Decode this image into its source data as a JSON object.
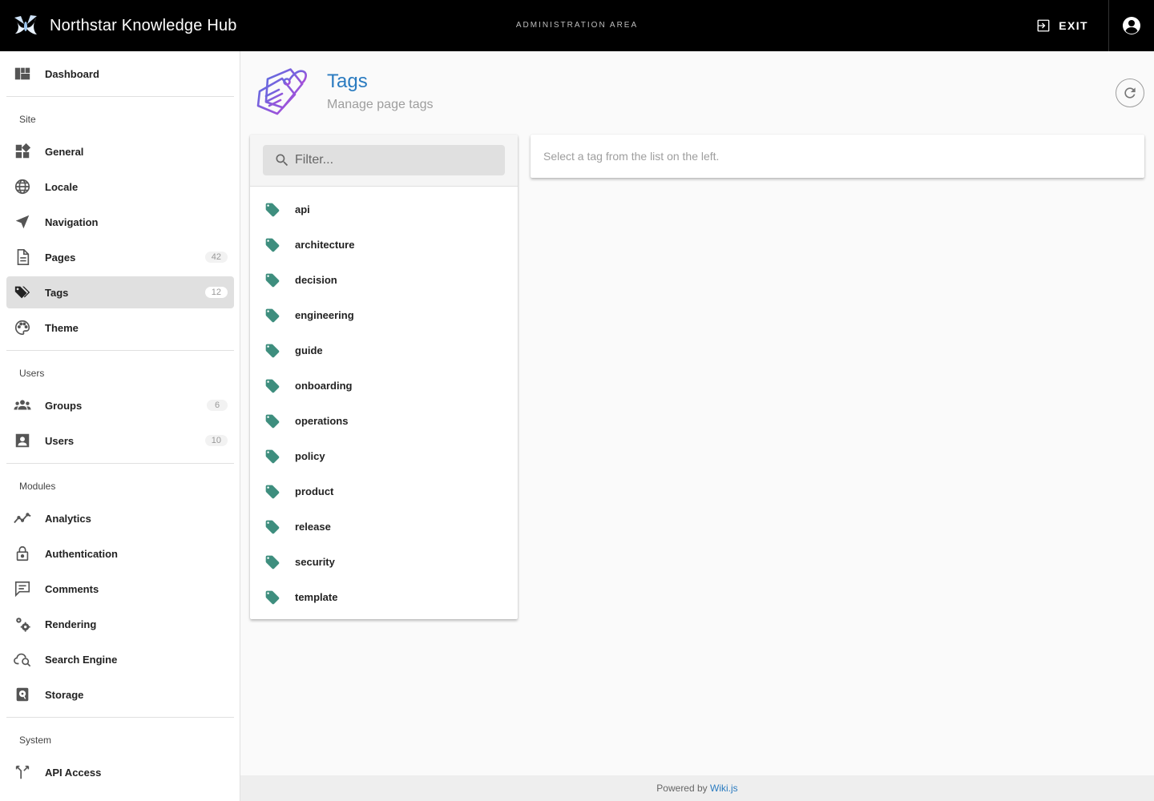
{
  "header": {
    "app_title": "Northstar Knowledge Hub",
    "area_label": "ADMINISTRATION AREA",
    "exit_label": "EXIT"
  },
  "sidebar": {
    "dashboard": {
      "label": "Dashboard",
      "icon": "dashboard-icon"
    },
    "sections": {
      "site": "Site",
      "users": "Users",
      "modules": "Modules",
      "system": "System"
    },
    "site_items": [
      {
        "label": "General",
        "icon": "general-icon"
      },
      {
        "label": "Locale",
        "icon": "globe-icon"
      },
      {
        "label": "Navigation",
        "icon": "navigation-icon"
      },
      {
        "label": "Pages",
        "icon": "page-icon",
        "badge": "42"
      },
      {
        "label": "Tags",
        "icon": "tags-icon",
        "badge": "12",
        "active": true
      },
      {
        "label": "Theme",
        "icon": "palette-icon"
      }
    ],
    "user_items": [
      {
        "label": "Groups",
        "icon": "groups-icon",
        "badge": "6"
      },
      {
        "label": "Users",
        "icon": "user-icon",
        "badge": "10"
      }
    ],
    "module_items": [
      {
        "label": "Analytics",
        "icon": "analytics-icon"
      },
      {
        "label": "Authentication",
        "icon": "lock-icon"
      },
      {
        "label": "Comments",
        "icon": "comment-icon"
      },
      {
        "label": "Rendering",
        "icon": "gears-icon"
      },
      {
        "label": "Search Engine",
        "icon": "cloud-search-icon"
      },
      {
        "label": "Storage",
        "icon": "storage-icon"
      }
    ],
    "system_items": [
      {
        "label": "API Access",
        "icon": "api-icon"
      }
    ]
  },
  "main": {
    "title": "Tags",
    "subtitle": "Manage page tags",
    "filter_placeholder": "Filter...",
    "tags": [
      "api",
      "architecture",
      "decision",
      "engineering",
      "guide",
      "onboarding",
      "operations",
      "policy",
      "product",
      "release",
      "security",
      "template"
    ],
    "empty_message": "Select a tag from the list on the left."
  },
  "footer": {
    "powered_by": "Powered by",
    "link_text": "Wiki.js"
  },
  "colors": {
    "header_bg": "#000000",
    "accent": "#2a7bc0",
    "tag_icon": "#3e8e7e",
    "active_item_bg": "#e0e0e0"
  }
}
